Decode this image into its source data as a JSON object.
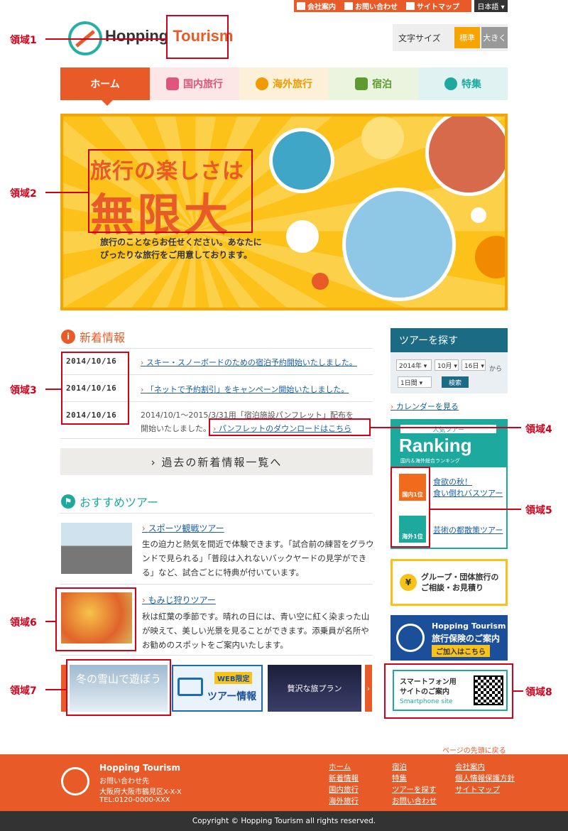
{
  "topbar": {
    "company": "会社案内",
    "contact": "お問い合わせ",
    "sitemap": "サイトマップ",
    "language": "日本語 ▾"
  },
  "logo": {
    "part1": "Hopping",
    "part2": "Tourism"
  },
  "fontsize": {
    "label": "文字サイズ",
    "standard": "標準",
    "large": "大きく"
  },
  "nav": {
    "home": "ホーム",
    "domestic": "国内旅行",
    "overseas": "海外旅行",
    "lodging": "宿泊",
    "special": "特集"
  },
  "hero": {
    "title1": "旅行の楽しさは",
    "title2": "無限大",
    "text": "旅行のことならお任せください。あなたにぴったりな旅行をご用意しております。"
  },
  "annotations": {
    "r1": "領域1",
    "r2": "領域2",
    "r3": "領域3",
    "r4": "領域4",
    "r5": "領域5",
    "r6": "領域6",
    "r7": "領域7",
    "r8": "領域8"
  },
  "news": {
    "title": "新着情報",
    "items": [
      {
        "date": "2014/10/16",
        "text": "スキー・スノーボードのための宿泊予約開始いたしました。"
      },
      {
        "date": "2014/10/16",
        "text": "「ネットで予約割引」をキャンペーン開始いたしました。"
      },
      {
        "date": "2014/10/16",
        "text1": "2014/10/1～2015/3/31用「宿泊施設パンフレット」配布を",
        "text2": "開始いたしました。",
        "link": "パンフレットのダウンロードはこちら"
      }
    ],
    "past": "› 過去の新着情報一覧へ"
  },
  "tours": {
    "title": "おすすめツアー",
    "items": [
      {
        "name": "スポーツ観戦ツアー",
        "desc": "生の迫力と熱気を間近で体験できます。「試合前の練習をグラウンドで見られる」「普段は入れないバックヤードの見学ができる」など、試合ごとに特典が付いています。"
      },
      {
        "name": "もみじ狩りツアー",
        "desc": "秋は紅葉の季節です。晴れの日には、青い空に紅く染まった山が映えて、美しい光景を見ることができます。添乗員が名所やお勧めのスポットをご案内いたします。"
      }
    ]
  },
  "banners": {
    "snow": "冬の雪山で遊ぼう",
    "web_tag": "WEB限定",
    "web": "ツアー情報",
    "luxury": "贅沢な旅プラン"
  },
  "sidebar": {
    "search_title": "ツアーを探す",
    "year": "2014年 ▾",
    "month": "10月 ▾",
    "day": "16日 ▾",
    "from": "から",
    "duration": "1日間 ▾",
    "search_btn": "検索",
    "calendar": "カレンダーを見る",
    "rank_sub": "人気ツアー",
    "rank_title": "Ranking",
    "rank_caption": "国内＆海外総合ランキング",
    "rank_dom_badge": "国内1位",
    "rank_dom_1": "食欲の秋！",
    "rank_dom_2": "食い倒れバスツアー",
    "rank_ovr_badge": "海外1位",
    "rank_ovr": "芸術の都散策ツアー",
    "group1": "グループ・団体旅行の",
    "group2": "ご相談・お見積り",
    "ins_brand": "Hopping Tourism",
    "ins_title": "旅行保険のご案内",
    "ins_btn": "ご加入はこちら",
    "smart1": "スマートフォン用",
    "smart2": "サイトのご案内",
    "smart3": "Smartphone site"
  },
  "footer": {
    "pagetop": "ページの先頭に戻る",
    "brand": "Hopping Tourism",
    "contact_label": "お問い合わせ先",
    "address": "大阪府大阪市鶴見区X-X-X",
    "tel": "TEL:0120-0000-XXX",
    "col1": [
      "ホーム",
      "新着情報",
      "国内旅行",
      "海外旅行"
    ],
    "col2": [
      "宿泊",
      "特集",
      "ツアーを探す",
      "お問い合わせ"
    ],
    "col3": [
      "会社案内",
      "個人情報保護方針",
      "サイトマップ"
    ],
    "copyright": "Copyright © Hopping  Tourism all rights reserved."
  },
  "colors": {
    "accent": "#e85a27",
    "teal": "#1ea99f",
    "navy": "#1c6b85",
    "yellow": "#fcc21a"
  }
}
